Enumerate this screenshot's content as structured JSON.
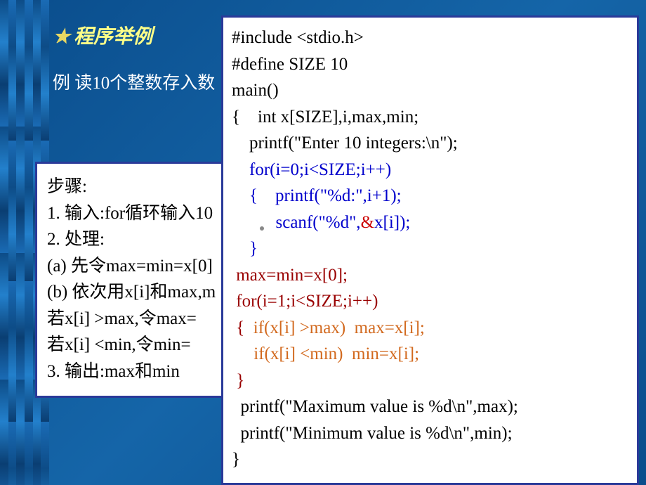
{
  "section_title": "程序举例",
  "example_text": "例  读10个整数存入数",
  "steps": {
    "title": "步骤:",
    "l1": "1. 输入:for循环输入10",
    "l2": "2. 处理:",
    "l3": "(a) 先令max=min=x[0]",
    "l4": "(b) 依次用x[i]和max,m",
    "l5": "      若x[i] >max,令max=",
    "l6": "      若x[i] <min,令min=",
    "l7": "3. 输出:max和min"
  },
  "code": {
    "c1": "#include <stdio.h>",
    "c2": "#define SIZE 10",
    "c3": "main()",
    "c4": "{    int x[SIZE],i,max,min;",
    "c5": "    printf(\"Enter 10 integers:\\n\");",
    "c6": "    for(i=0;i<SIZE;i++)",
    "c7a": "    {    printf(\"%d:\",i+1);",
    "c7b": "          scanf(\"%d\",",
    "c7c": "&",
    "c7d": "x[i]);",
    "c8": "    }",
    "c9": " max=min=x[0];",
    "c10": " for(i=1;i<SIZE;i++)",
    "c11a": " {",
    "c11b": "  if(x[i] >max)  max=x[i];",
    "c12": "     if(x[i] <min)  min=x[i];",
    "c13": " }",
    "c14": "  printf(\"Maximum value is %d\\n\",max);",
    "c15": "  printf(\"Minimum value is %d\\n\",min);",
    "c16": "}"
  }
}
